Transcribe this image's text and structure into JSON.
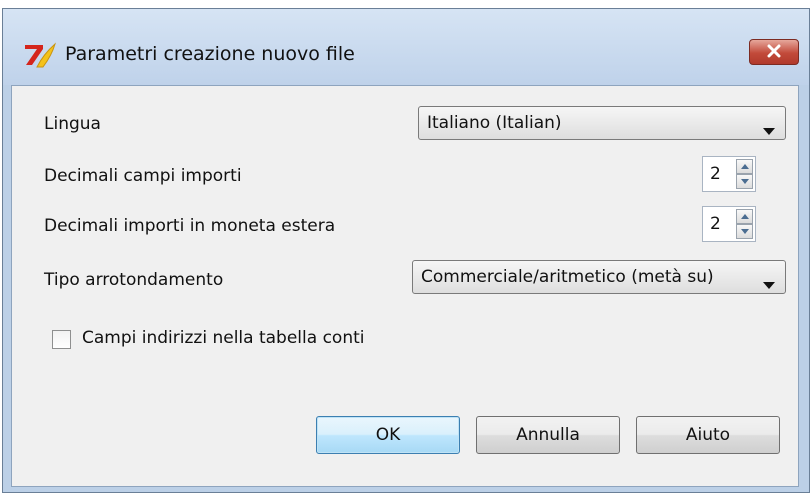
{
  "window": {
    "title": "Parametri creazione nuovo file",
    "icon": "app-logo-icon",
    "close_icon": "close-icon"
  },
  "form": {
    "language": {
      "label": "Lingua",
      "value": "Italiano (Italian)"
    },
    "decimals_amounts": {
      "label": "Decimali campi importi",
      "value": "2"
    },
    "decimals_foreign": {
      "label": "Decimali importi in moneta estera",
      "value": "2"
    },
    "rounding": {
      "label": "Tipo arrotondamento",
      "value": "Commerciale/aritmetico (metà su)"
    },
    "address_fields": {
      "label": "Campi indirizzi nella tabella conti",
      "checked": false
    }
  },
  "buttons": {
    "ok": "OK",
    "cancel": "Annulla",
    "help": "Aiuto"
  },
  "colors": {
    "close_red": "#c24a3a",
    "default_button_border": "#3c7fb1",
    "frame": "#bcd0e7"
  }
}
